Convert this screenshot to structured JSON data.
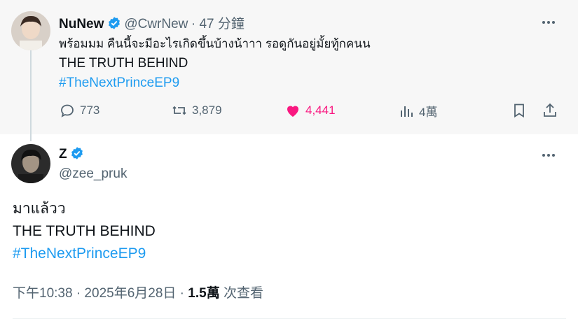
{
  "parent_tweet": {
    "display_name": "NuNew",
    "handle": "@CwrNew",
    "time": "· 47 分鐘",
    "lines": [
      "พร้อมมม คืนนี้จะมีอะไรเกิดขึ้นบ้างน้าาา รอดูกันอยู่มั้ยทู้กคนน",
      "THE TRUTH BEHIND"
    ],
    "hashtag": "#TheNextPrinceEP9",
    "replies": "773",
    "reposts": "3,879",
    "likes": "4,441",
    "views": "4萬"
  },
  "main_tweet": {
    "display_name": "Z",
    "handle": "@zee_pruk",
    "lines": [
      "มาแล้วว",
      "THE TRUTH BEHIND"
    ],
    "hashtag": "#TheNextPrinceEP9",
    "timestamp": "下午10:38 · 2025年6月28日 · ",
    "view_count": "1.5萬",
    "view_label": " 次查看"
  },
  "colors": {
    "accent": "#1d9bf0",
    "like": "#f91880",
    "muted": "#536471",
    "text": "#0f1419"
  },
  "icons": [
    "verified-badge-icon",
    "more-icon",
    "reply-icon",
    "repost-icon",
    "heart-icon",
    "views-icon",
    "bookmark-icon",
    "share-icon"
  ]
}
